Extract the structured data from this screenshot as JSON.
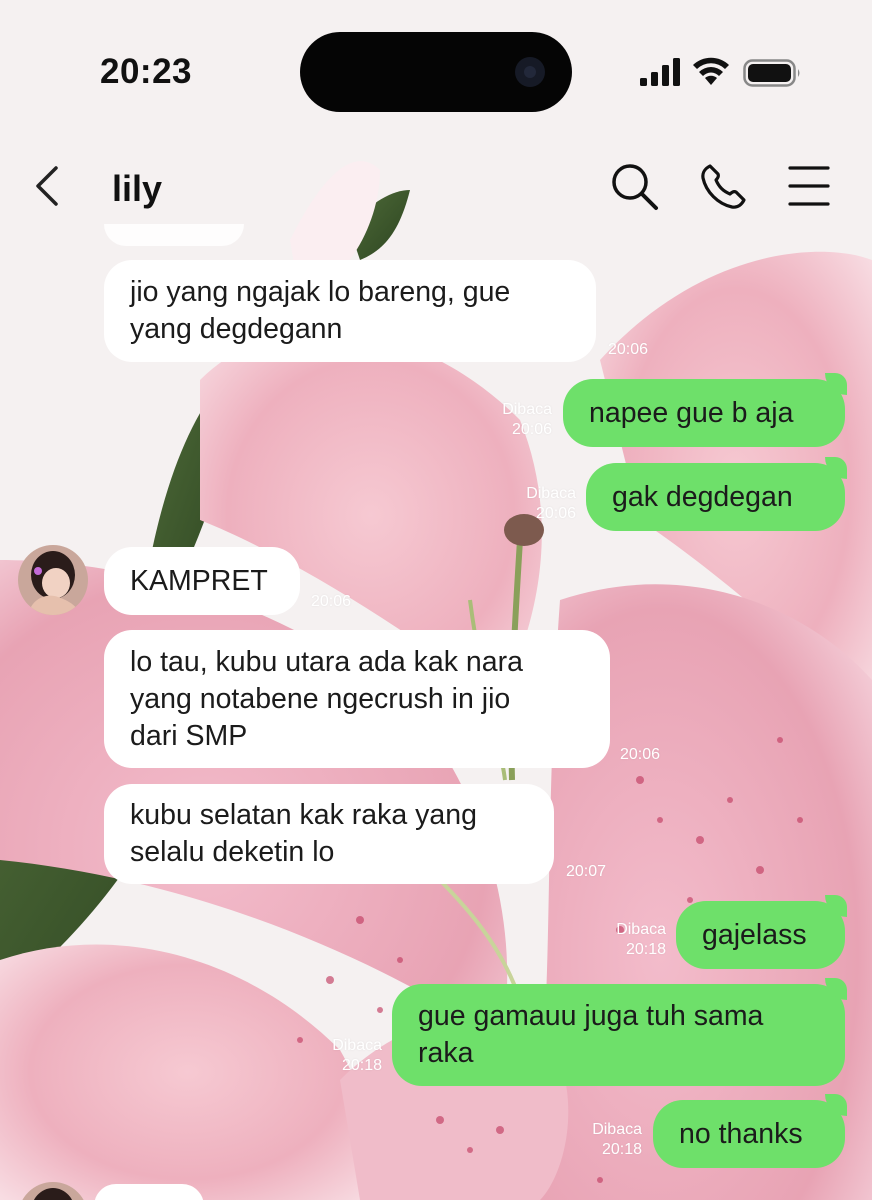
{
  "status": {
    "time": "20:23"
  },
  "chat": {
    "title": "lily"
  },
  "messages": [
    {
      "direction": "in",
      "text": "jio yang ngajak lo bareng, gue\nyang degdegann",
      "time": "20:06"
    },
    {
      "direction": "out",
      "text": "napee gue b aja",
      "read": "Dibaca",
      "time": "20:06"
    },
    {
      "direction": "out",
      "text": "gak degdegan",
      "read": "Dibaca",
      "time": "20:06"
    },
    {
      "direction": "in",
      "text": "KAMPRET",
      "time": "20:06"
    },
    {
      "direction": "in",
      "text": "lo tau, kubu utara ada kak nara\nyang notabene ngecrush in jio\ndari SMP",
      "time": "20:06"
    },
    {
      "direction": "in",
      "text": "kubu selatan kak raka yang\nselalu deketin lo",
      "time": "20:07"
    },
    {
      "direction": "out",
      "text": "gajelass",
      "read": "Dibaca",
      "time": "20:18"
    },
    {
      "direction": "out",
      "text": "gue gamauu juga tuh sama\nraka",
      "read": "Dibaca",
      "time": "20:18"
    },
    {
      "direction": "out",
      "text": "no thanks",
      "read": "Dibaca",
      "time": "20:18"
    }
  ],
  "colors": {
    "outgoing_bubble": "#6ee06a",
    "incoming_bubble": "#ffffff",
    "meta_text": "#ffffff"
  },
  "icons": [
    "back-icon",
    "search-icon",
    "phone-icon",
    "menu-icon",
    "avatar"
  ]
}
